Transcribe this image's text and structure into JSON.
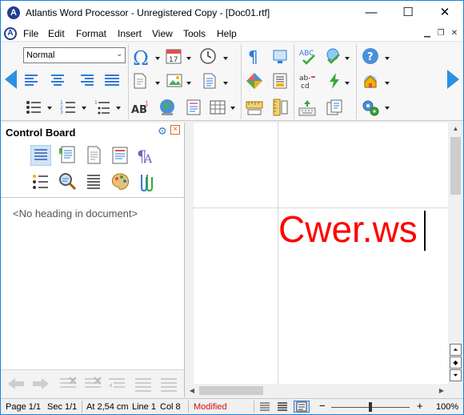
{
  "window": {
    "title": "Atlantis Word Processor - Unregistered Copy - [Doc01.rtf]",
    "minimize_symbol": "—",
    "maximize_symbol": "☐",
    "close_symbol": "✕"
  },
  "menu": {
    "items": [
      "File",
      "Edit",
      "Format",
      "Insert",
      "View",
      "Tools",
      "Help"
    ]
  },
  "toolbar": {
    "style_value": "Normal",
    "icons": [
      "symbol-omega-icon",
      "insert-date-icon",
      "insert-time-icon",
      "paragraph-marks-icon",
      "full-screen-icon",
      "spellcheck-icon",
      "spellcheck-online-icon",
      "help-icon",
      "align-left-icon",
      "align-center-icon",
      "align-right-icon",
      "justify-icon",
      "page-setup-icon",
      "insert-picture-icon",
      "document-icon",
      "grid-icon",
      "text-icon",
      "hyphenation-icon",
      "autocorrect-icon",
      "home-icon",
      "bullets-icon",
      "numbering-icon",
      "multilevel-list-icon",
      "font-icon",
      "globe-icon",
      "insert-object-icon",
      "table-icon",
      "ruler-h-icon",
      "ruler-v-icon",
      "keyboard-icon",
      "notes-icon",
      "options-icon"
    ],
    "accent": "#2f8fe0"
  },
  "control_board": {
    "title": "Control Board",
    "empty_message": "<No heading in document>"
  },
  "document": {
    "text": "Cwer.ws",
    "text_color": "#ff0000"
  },
  "status": {
    "page": "Page 1/1",
    "section": "Sec 1/1",
    "position": "At 2,54 cm",
    "line": "Line 1",
    "column": "Col 8",
    "modified": "Modified",
    "modified_color": "#d01010",
    "zoom_out": "−",
    "zoom_in": "+",
    "zoom": "100%",
    "zoom_level_percent": 100
  }
}
